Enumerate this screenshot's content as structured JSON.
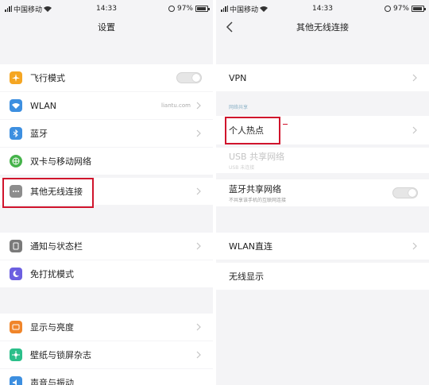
{
  "left": {
    "status": {
      "carrier": "中国移动",
      "time": "14:33",
      "battery": "97%"
    },
    "title": "设置",
    "items": [
      {
        "label": "飞行模式",
        "icon": "airplane-icon",
        "color": "#f5a623",
        "control": "toggle"
      },
      {
        "label": "WLAN",
        "value": "liantu.com",
        "icon": "wlan-icon",
        "color": "#3d8fe0"
      },
      {
        "label": "蓝牙",
        "icon": "bluetooth-icon",
        "color": "#3d8fe0"
      },
      {
        "label": "双卡与移动网络",
        "icon": "globe-icon",
        "color": "#45b34a"
      },
      {
        "label": "其他无线连接",
        "icon": "more-icon",
        "color": "#8d8d8d"
      },
      {
        "label": "通知与状态栏",
        "icon": "notification-icon",
        "color": "#7a7a7a"
      },
      {
        "label": "免打扰模式",
        "icon": "moon-icon",
        "color": "#6c5fe0"
      },
      {
        "label": "显示与亮度",
        "icon": "display-icon",
        "color": "#f0852a"
      },
      {
        "label": "壁纸与锁屏杂志",
        "icon": "wallpaper-icon",
        "color": "#2bbf8a"
      },
      {
        "label": "声音与振动",
        "icon": "sound-icon",
        "color": "#3d8fe0"
      }
    ]
  },
  "right": {
    "status": {
      "carrier": "中国移动",
      "time": "14:33",
      "battery": "97%"
    },
    "title": "其他无线连接",
    "vpn": "VPN",
    "section": "网络共享",
    "hotspot": "个人热点",
    "usb": {
      "label": "USB 共享网络",
      "sub": "USB 未连接"
    },
    "bt_share": {
      "label": "蓝牙共享网络",
      "sub": "不共享该手机的互联网连接"
    },
    "wlan_direct": "WLAN直连",
    "wireless_display": "无线显示"
  }
}
